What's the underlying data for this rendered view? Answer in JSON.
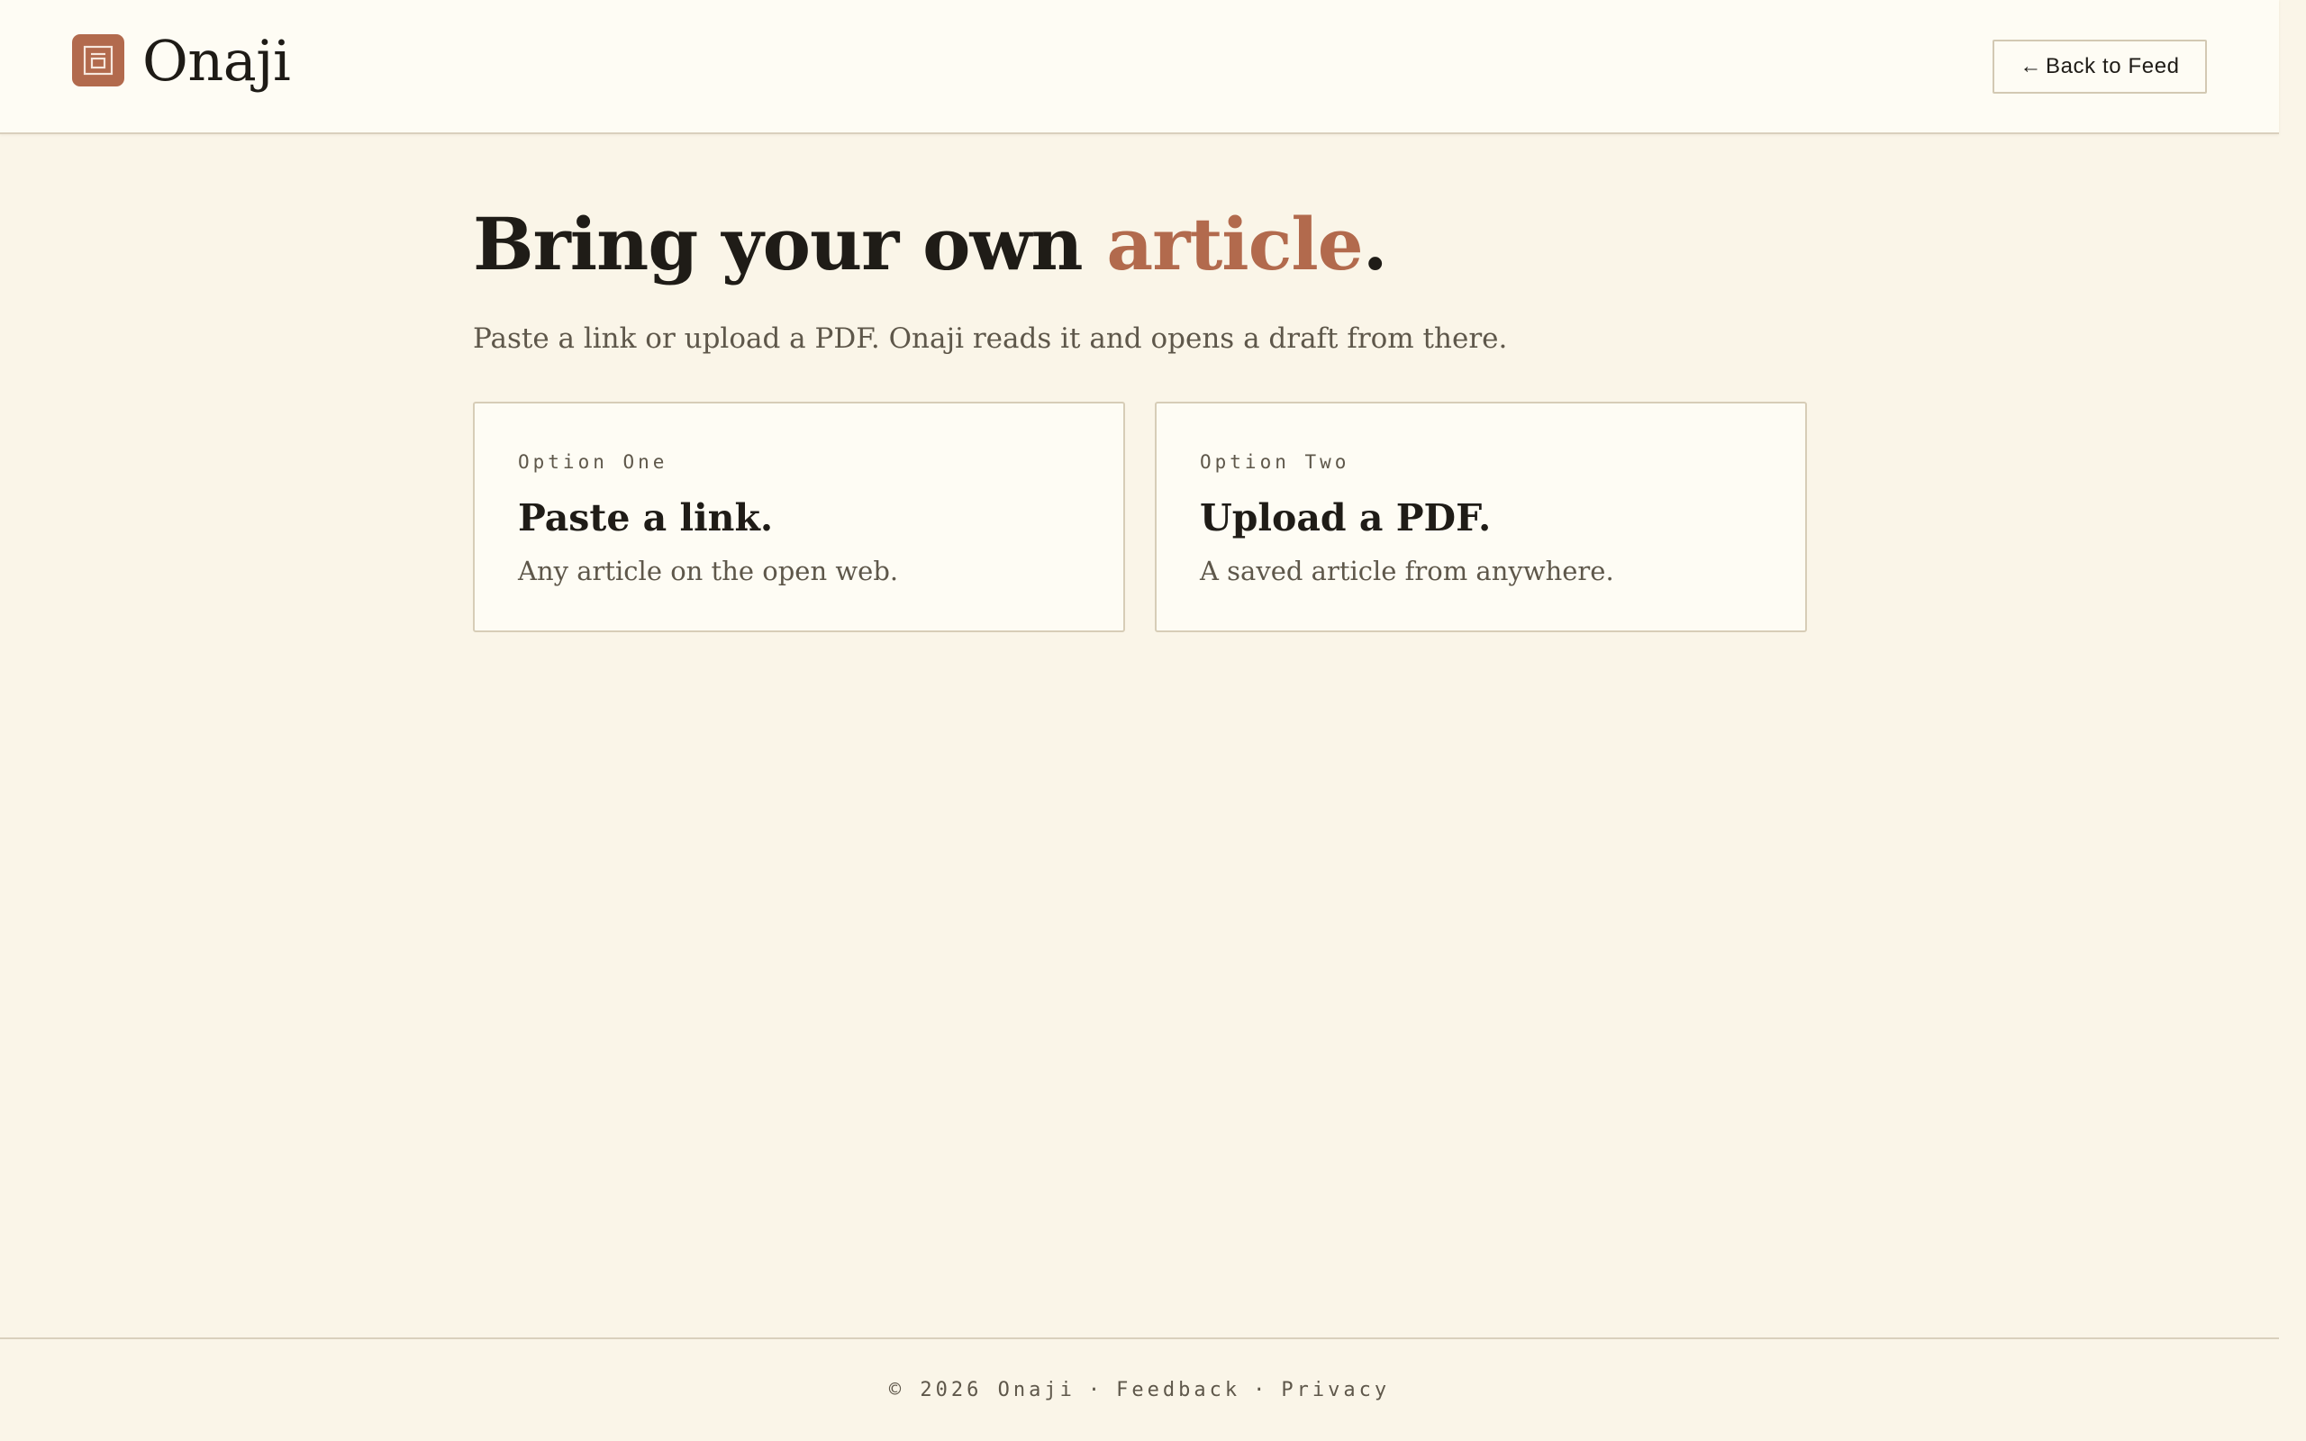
{
  "header": {
    "brand": "Onaji",
    "logo_icon": "square-glyph-icon",
    "back_arrow": "←",
    "back_label": "Back to Feed"
  },
  "main": {
    "title_prefix": "Bring your own ",
    "title_accent": "article",
    "title_suffix": ".",
    "subtitle": "Paste a link or upload a PDF. Onaji reads it and opens a draft from there."
  },
  "options": [
    {
      "eyebrow": "Option One",
      "title": "Paste a link.",
      "description": "Any article on the open web."
    },
    {
      "eyebrow": "Option Two",
      "title": "Upload a PDF.",
      "description": "A saved article from anywhere."
    }
  ],
  "footer": {
    "copyright": "© 2026 Onaji",
    "separator": "·",
    "feedback": "Feedback",
    "privacy": "Privacy"
  },
  "colors": {
    "accent": "#b26a4d",
    "background": "#faf5e8",
    "surface": "#fefcf4",
    "text": "#1f1c17",
    "muted": "#5e574a",
    "border": "#d7cdb7"
  }
}
